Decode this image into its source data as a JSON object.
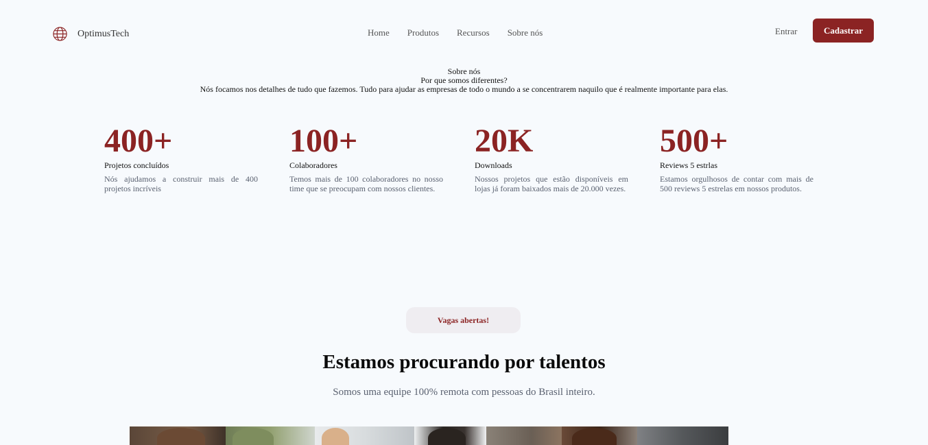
{
  "header": {
    "brand": {
      "name": "OptimusTech",
      "icon": "globe-icon",
      "color": "#8b2323"
    },
    "nav": [
      {
        "label": "Home"
      },
      {
        "label": "Produtos"
      },
      {
        "label": "Recursos"
      },
      {
        "label": "Sobre nós"
      }
    ],
    "login_label": "Entrar",
    "signup_label": "Cadastrar"
  },
  "about": {
    "eyebrow": "Sobre nós",
    "title": "Por que somos diferentes?",
    "description": "Nós focamos nos detalhes de tudo que fazemos. Tudo para ajudar as empresas de todo o mundo a se concentrarem naquilo que é realmente importante para elas."
  },
  "stats": [
    {
      "value": "400+",
      "title": "Projetos concluídos",
      "description": "Nós ajudamos a construir mais de 400 projetos incríveis"
    },
    {
      "value": "100+",
      "title": "Colaboradores",
      "description": "Temos mais de 100 colaboradores no nosso time que se preocupam com nossos clientes."
    },
    {
      "value": "20K",
      "title": "Downloads",
      "description": "Nossos projetos que estão disponíveis em lojas já foram baixados mais de 20.000 vezes."
    },
    {
      "value": "500+",
      "title": "Reviews 5 estrlas",
      "description": "Estamos orgulhosos de contar com mais de 500 reviews 5 estrelas em nossos produtos."
    }
  ],
  "jobs": {
    "badge": "Vagas abertas!",
    "title": "Estamos procurando por talentos",
    "subtitle": "Somos uma equipe 100% remota com pessoas do Brasil inteiro."
  },
  "colors": {
    "accent": "#8b2323",
    "background": "#f7fafd",
    "muted_text": "#5a6170",
    "badge_bg": "#efedf1"
  }
}
